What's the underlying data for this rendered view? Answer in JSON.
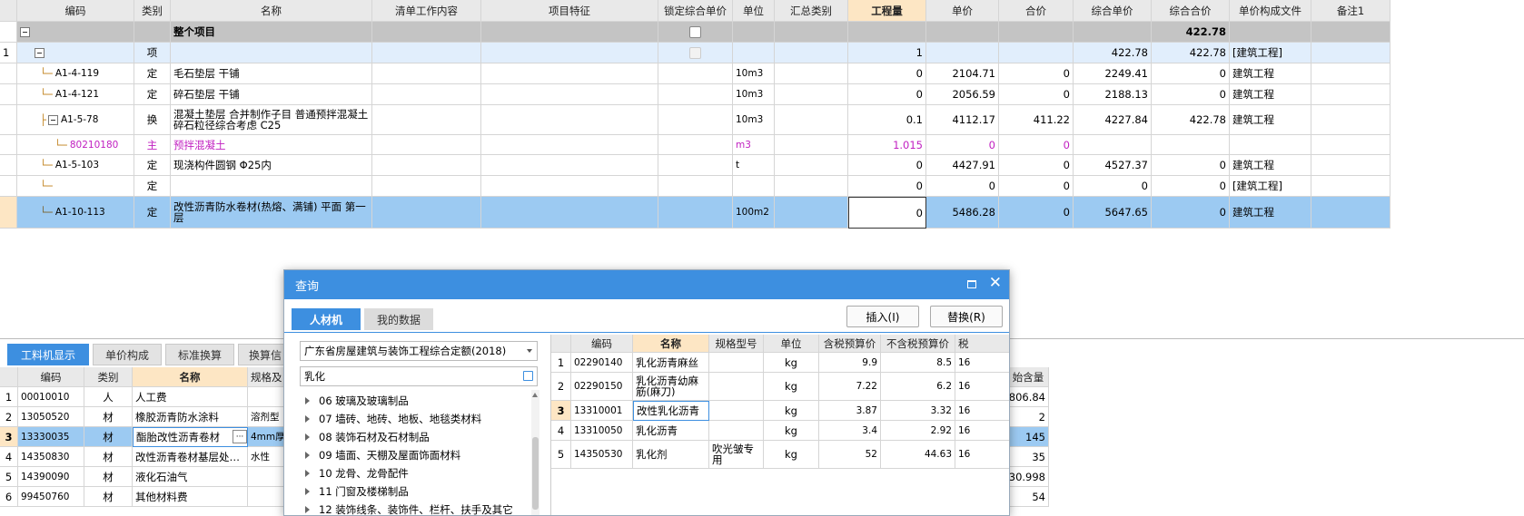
{
  "main_table": {
    "headers": [
      "编码",
      "类别",
      "名称",
      "清单工作内容",
      "项目特征",
      "锁定综合单价",
      "单位",
      "汇总类别",
      "工程量",
      "单价",
      "合价",
      "综合单价",
      "综合合价",
      "单价构成文件",
      "备注1"
    ],
    "total_row": {
      "name": "整个项目",
      "total": "422.78"
    },
    "rows": [
      {
        "no": "1",
        "code": "",
        "type": "项",
        "name": "",
        "unit": "",
        "qty": "1",
        "price": "",
        "total": "",
        "unit_comp": "422.78",
        "comp_total": "422.78",
        "file": "[建筑工程]"
      },
      {
        "no": "",
        "code": "A1-4-119",
        "type": "定",
        "name": "毛石垫层 干铺",
        "unit": "10m3",
        "qty": "0",
        "price": "2104.71",
        "total": "0",
        "unit_comp": "2249.41",
        "comp_total": "0",
        "file": "建筑工程"
      },
      {
        "no": "",
        "code": "A1-4-121",
        "type": "定",
        "name": "碎石垫层 干铺",
        "unit": "10m3",
        "qty": "0",
        "price": "2056.59",
        "total": "0",
        "unit_comp": "2188.13",
        "comp_total": "0",
        "file": "建筑工程"
      },
      {
        "no": "",
        "code": "A1-5-78",
        "type": "换",
        "name": "混凝土垫层  合并制作子目 普通预拌混凝土 碎石粒径综合考虑 C25",
        "unit": "10m3",
        "qty": "0.1",
        "price": "4112.17",
        "total": "411.22",
        "unit_comp": "4227.84",
        "comp_total": "422.78",
        "file": "建筑工程"
      },
      {
        "no": "",
        "code": "80210180",
        "type": "主",
        "name": "预拌混凝土",
        "unit": "m3",
        "qty": "1.015",
        "price": "0",
        "total": "0",
        "unit_comp": "",
        "comp_total": "",
        "file": ""
      },
      {
        "no": "",
        "code": "A1-5-103",
        "type": "定",
        "name": "现浇构件圆钢 Φ25内",
        "unit": "t",
        "qty": "0",
        "price": "4427.91",
        "total": "0",
        "unit_comp": "4527.37",
        "comp_total": "0",
        "file": "建筑工程"
      },
      {
        "no": "",
        "code": "",
        "type": "定",
        "name": "",
        "unit": "",
        "qty": "0",
        "price": "0",
        "total": "0",
        "unit_comp": "0",
        "comp_total": "0",
        "file": "[建筑工程]"
      },
      {
        "no": "",
        "code": "A1-10-113",
        "type": "定",
        "name": "改性沥青防水卷材(热熔、满铺) 平面 第一层",
        "unit": "100m2",
        "qty": "0",
        "price": "5486.28",
        "total": "0",
        "unit_comp": "5647.65",
        "comp_total": "0",
        "file": "建筑工程"
      }
    ]
  },
  "bottom_tabs": [
    "工料机显示",
    "单价构成",
    "标准换算",
    "换算信"
  ],
  "bottom_table": {
    "headers": [
      "编码",
      "类别",
      "名称",
      "规格及"
    ],
    "right_header": "始含量",
    "rows": [
      {
        "no": "1",
        "code": "00010010",
        "type": "人",
        "name": "人工费",
        "spec": "",
        "right": "806.84"
      },
      {
        "no": "2",
        "code": "13050520",
        "type": "材",
        "name": "橡胶沥青防水涂料",
        "spec": "溶剂型",
        "right": "2"
      },
      {
        "no": "3",
        "code": "13330035",
        "type": "材",
        "name": "酯胎改性沥青卷材",
        "spec": "4mm厚",
        "right": "145"
      },
      {
        "no": "4",
        "code": "14350830",
        "type": "材",
        "name": "改性沥青卷材基层处…",
        "spec": "水性",
        "right": "35"
      },
      {
        "no": "5",
        "code": "14390090",
        "type": "材",
        "name": "液化石油气",
        "spec": "",
        "right": "30.998"
      },
      {
        "no": "6",
        "code": "99450760",
        "type": "材",
        "name": "其他材料费",
        "spec": "",
        "right": "54"
      }
    ],
    "ellipsis_button": "···"
  },
  "dialog": {
    "title": "查询",
    "tabs": [
      "人材机",
      "我的数据"
    ],
    "insert_button": "插入(I)",
    "replace_button": "替换(R)",
    "quota_select": "广东省房屋建筑与装饰工程综合定额(2018)",
    "search_value": "乳化",
    "tree_items": [
      "06 玻璃及玻璃制品",
      "07 墙砖、地砖、地板、地毯类材料",
      "08 装饰石材及石材制品",
      "09 墙面、天棚及屋面饰面材料",
      "10 龙骨、龙骨配件",
      "11 门窗及楼梯制品",
      "12 装饰线条、装饰件、栏杆、扶手及其它"
    ],
    "result_headers": [
      "编码",
      "名称",
      "规格型号",
      "单位",
      "含税预算价",
      "不含税预算价",
      "税"
    ],
    "results": [
      {
        "no": "1",
        "code": "02290140",
        "name": "乳化沥青麻丝",
        "spec": "",
        "unit": "kg",
        "tax_price": "9.9",
        "notax_price": "8.5",
        "tax": "16"
      },
      {
        "no": "2",
        "code": "02290150",
        "name": "乳化沥青幼麻筋(麻刀)",
        "spec": "",
        "unit": "kg",
        "tax_price": "7.22",
        "notax_price": "6.2",
        "tax": "16"
      },
      {
        "no": "3",
        "code": "13310001",
        "name": "改性乳化沥青",
        "spec": "",
        "unit": "kg",
        "tax_price": "3.87",
        "notax_price": "3.32",
        "tax": "16"
      },
      {
        "no": "4",
        "code": "13310050",
        "name": "乳化沥青",
        "spec": "",
        "unit": "kg",
        "tax_price": "3.4",
        "notax_price": "2.92",
        "tax": "16"
      },
      {
        "no": "5",
        "code": "14350530",
        "name": "乳化剂",
        "spec": "吹光皱专用",
        "unit": "kg",
        "tax_price": "52",
        "notax_price": "44.63",
        "tax": "16"
      }
    ]
  },
  "colors": {
    "accent": "#3d8fe0",
    "selected_row": "#9ccaf2",
    "light_row": "#e1eefc",
    "total_row": "#c4c4c4",
    "main_material": "#c11fc1",
    "header_highlight": "#fde6c4"
  }
}
